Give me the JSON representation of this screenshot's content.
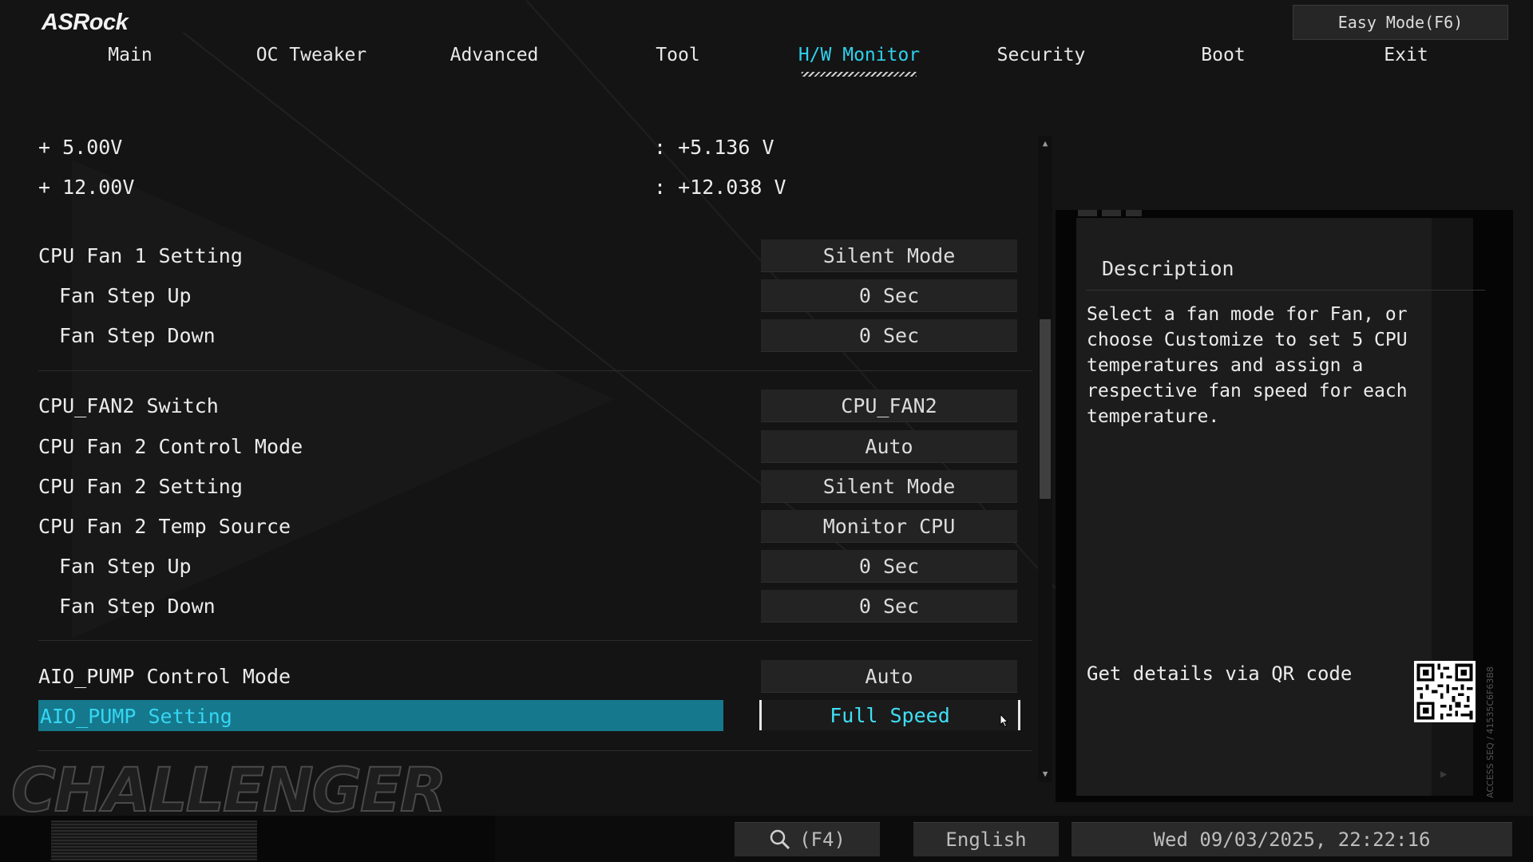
{
  "brand": "ASRock",
  "easy_mode": "Easy Mode(F6)",
  "tabs": [
    "Main",
    "OC Tweaker",
    "Advanced",
    "Tool",
    "H/W Monitor",
    "Security",
    "Boot",
    "Exit"
  ],
  "active_tab": "H/W Monitor",
  "voltages": [
    {
      "label": "+ 5.00V",
      "value": ": +5.136 V"
    },
    {
      "label": "+ 12.00V",
      "value": ": +12.038 V"
    }
  ],
  "settings": [
    {
      "label": "CPU Fan 1 Setting",
      "value": "Silent Mode"
    },
    {
      "label": "Fan Step Up",
      "value": "0 Sec"
    },
    {
      "label": "Fan Step Down",
      "value": "0 Sec"
    },
    {
      "label": "CPU_FAN2 Switch",
      "value": "CPU_FAN2"
    },
    {
      "label": "CPU Fan 2 Control Mode",
      "value": "Auto"
    },
    {
      "label": "CPU Fan 2 Setting",
      "value": "Silent Mode"
    },
    {
      "label": "CPU Fan 2 Temp Source",
      "value": "Monitor CPU"
    },
    {
      "label": "Fan Step Up",
      "value": "0 Sec"
    },
    {
      "label": "Fan Step Down",
      "value": "0 Sec"
    },
    {
      "label": "AIO_PUMP Control Mode",
      "value": "Auto"
    },
    {
      "label": "AIO_PUMP Setting",
      "value": "Full Speed"
    }
  ],
  "description": {
    "title": "Description",
    "text": "Select a fan mode for Fan, or choose Customize to set 5 CPU temperatures and assign a respective fan speed for each temperature.",
    "qr_label": "Get details via QR code",
    "vertical_code": "ACCESS SEQ / 41535C6F63B8"
  },
  "watermark": "CHALLENGER",
  "footer": {
    "search": "(F4)",
    "language": "English",
    "datetime": "Wed 09/03/2025, 22:22:16"
  },
  "icons": {
    "search": "magnifier-icon",
    "scroll_up": "triangle-up-icon",
    "scroll_down": "triangle-down-icon",
    "cursor": "mouse-pointer-icon",
    "play": "triangle-right-icon"
  },
  "colors": {
    "highlight_band": "#16788c",
    "highlight_text": "#35d6f3",
    "active_tab": "#2fd0ee"
  }
}
